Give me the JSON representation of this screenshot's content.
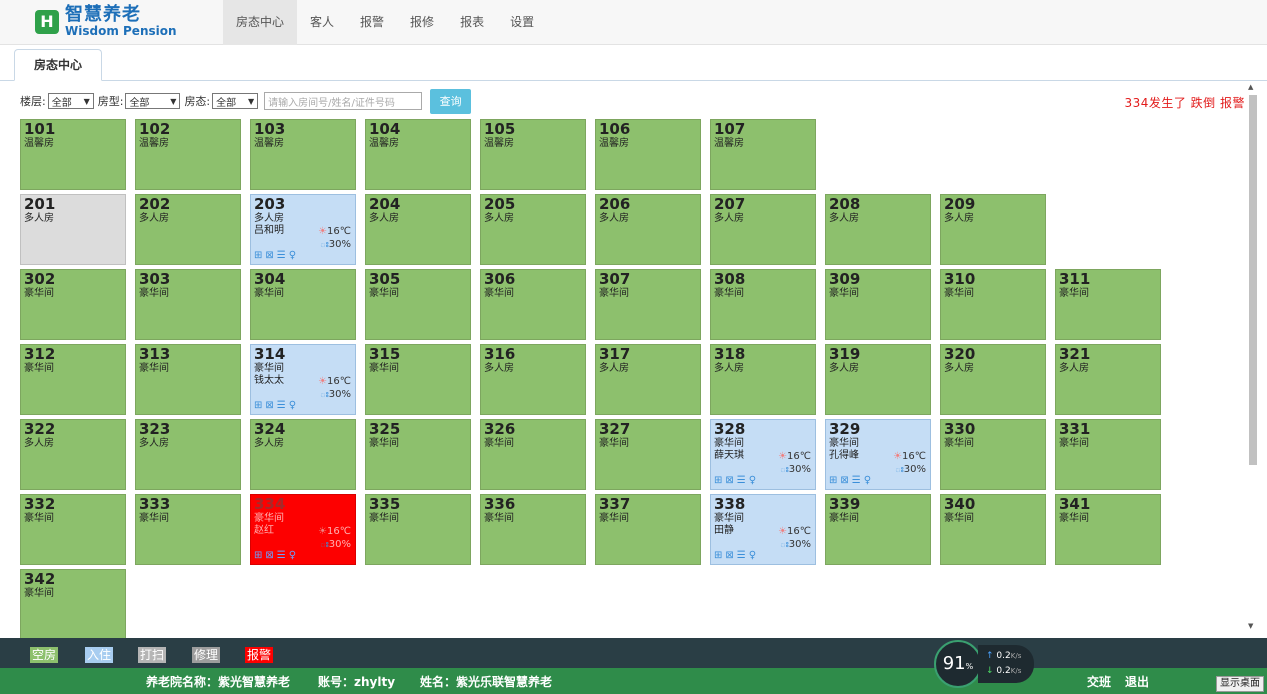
{
  "app": {
    "logo_cn": "智慧养老",
    "logo_en": "Wisdom Pension",
    "logo_icon": "H"
  },
  "nav": [
    "房态中心",
    "客人",
    "报警",
    "报修",
    "报表",
    "设置"
  ],
  "tab": "房态中心",
  "filters": {
    "floor_label": "楼层:",
    "floor_value": "全部",
    "type_label": "房型:",
    "type_value": "全部",
    "state_label": "房态:",
    "state_value": "全部",
    "search_placeholder": "请输入房间号/姓名/证件号码",
    "query_button": "查询"
  },
  "alert": "334发生了 跌倒 报警",
  "colors": {
    "vacant": "#8dc06d",
    "occupied": "#c5ddf5",
    "cleaning": "#dcdcdc",
    "repair": "#9d9d9d",
    "alarm": "#fd0000"
  },
  "rooms": [
    {
      "num": "101",
      "type": "温馨房",
      "state": "vacant"
    },
    {
      "num": "102",
      "type": "温馨房",
      "state": "vacant"
    },
    {
      "num": "103",
      "type": "温馨房",
      "state": "vacant"
    },
    {
      "num": "104",
      "type": "温馨房",
      "state": "vacant"
    },
    {
      "num": "105",
      "type": "温馨房",
      "state": "vacant"
    },
    {
      "num": "106",
      "type": "温馨房",
      "state": "vacant"
    },
    {
      "num": "107",
      "type": "温馨房",
      "state": "vacant"
    },
    {
      "num": "201",
      "type": "多人房",
      "state": "cleaning"
    },
    {
      "num": "202",
      "type": "多人房",
      "state": "vacant"
    },
    {
      "num": "203",
      "type": "多人房",
      "state": "occupied",
      "guest": "吕和明",
      "temp": "16℃",
      "humidity": "30%"
    },
    {
      "num": "204",
      "type": "多人房",
      "state": "vacant"
    },
    {
      "num": "205",
      "type": "多人房",
      "state": "vacant"
    },
    {
      "num": "206",
      "type": "多人房",
      "state": "vacant"
    },
    {
      "num": "207",
      "type": "多人房",
      "state": "vacant"
    },
    {
      "num": "208",
      "type": "多人房",
      "state": "vacant"
    },
    {
      "num": "209",
      "type": "多人房",
      "state": "vacant"
    },
    {
      "num": "302",
      "type": "豪华间",
      "state": "vacant"
    },
    {
      "num": "303",
      "type": "豪华间",
      "state": "vacant"
    },
    {
      "num": "304",
      "type": "豪华间",
      "state": "vacant"
    },
    {
      "num": "305",
      "type": "豪华间",
      "state": "vacant"
    },
    {
      "num": "306",
      "type": "豪华间",
      "state": "vacant"
    },
    {
      "num": "307",
      "type": "豪华间",
      "state": "vacant"
    },
    {
      "num": "308",
      "type": "豪华间",
      "state": "vacant"
    },
    {
      "num": "309",
      "type": "豪华间",
      "state": "vacant"
    },
    {
      "num": "310",
      "type": "豪华间",
      "state": "vacant"
    },
    {
      "num": "311",
      "type": "豪华间",
      "state": "vacant"
    },
    {
      "num": "312",
      "type": "豪华间",
      "state": "vacant"
    },
    {
      "num": "313",
      "type": "豪华间",
      "state": "vacant"
    },
    {
      "num": "314",
      "type": "豪华间",
      "state": "occupied",
      "guest": "钱太太",
      "temp": "16℃",
      "humidity": "30%"
    },
    {
      "num": "315",
      "type": "豪华间",
      "state": "vacant"
    },
    {
      "num": "316",
      "type": "多人房",
      "state": "vacant"
    },
    {
      "num": "317",
      "type": "多人房",
      "state": "vacant"
    },
    {
      "num": "318",
      "type": "多人房",
      "state": "vacant"
    },
    {
      "num": "319",
      "type": "多人房",
      "state": "vacant"
    },
    {
      "num": "320",
      "type": "多人房",
      "state": "vacant"
    },
    {
      "num": "321",
      "type": "多人房",
      "state": "vacant"
    },
    {
      "num": "322",
      "type": "多人房",
      "state": "vacant"
    },
    {
      "num": "323",
      "type": "多人房",
      "state": "vacant"
    },
    {
      "num": "324",
      "type": "多人房",
      "state": "vacant"
    },
    {
      "num": "325",
      "type": "豪华间",
      "state": "vacant"
    },
    {
      "num": "326",
      "type": "豪华间",
      "state": "vacant"
    },
    {
      "num": "327",
      "type": "豪华间",
      "state": "vacant"
    },
    {
      "num": "328",
      "type": "豪华间",
      "state": "occupied",
      "guest": "薛天琪",
      "temp": "16℃",
      "humidity": "30%"
    },
    {
      "num": "329",
      "type": "豪华间",
      "state": "occupied",
      "guest": "孔得峰",
      "temp": "16℃",
      "humidity": "30%"
    },
    {
      "num": "330",
      "type": "豪华间",
      "state": "vacant"
    },
    {
      "num": "331",
      "type": "豪华间",
      "state": "vacant"
    },
    {
      "num": "332",
      "type": "豪华间",
      "state": "vacant"
    },
    {
      "num": "333",
      "type": "豪华间",
      "state": "vacant"
    },
    {
      "num": "334",
      "type": "豪华间",
      "state": "alarm",
      "guest": "赵红",
      "temp": "16℃",
      "humidity": "30%"
    },
    {
      "num": "335",
      "type": "豪华间",
      "state": "vacant"
    },
    {
      "num": "336",
      "type": "豪华间",
      "state": "vacant"
    },
    {
      "num": "337",
      "type": "豪华间",
      "state": "vacant"
    },
    {
      "num": "338",
      "type": "豪华间",
      "state": "occupied",
      "guest": "田静",
      "temp": "16℃",
      "humidity": "30%"
    },
    {
      "num": "339",
      "type": "豪华间",
      "state": "vacant"
    },
    {
      "num": "340",
      "type": "豪华间",
      "state": "vacant"
    },
    {
      "num": "341",
      "type": "豪华间",
      "state": "vacant"
    },
    {
      "num": "342",
      "type": "豪华间",
      "state": "vacant"
    }
  ],
  "legend": [
    {
      "label": "空房",
      "color": "#8dc06d"
    },
    {
      "label": "入住",
      "color": "#a8cdf0"
    },
    {
      "label": "打扫",
      "color": "#b5b5b5"
    },
    {
      "label": "修理",
      "color": "#9d9d9d"
    },
    {
      "label": "报警",
      "color": "#fd0000"
    }
  ],
  "status": {
    "org": "养老院名称：紫光智慧养老",
    "account": "账号：zhylty",
    "name": "姓名：紫光乐联智慧养老",
    "handover": "交班",
    "logout": "退出"
  },
  "net_widget": {
    "percent": "91",
    "percent_unit": "%",
    "up": "0.2",
    "down": "0.2",
    "unit": "K/s"
  },
  "desktop_button": "显示桌面"
}
